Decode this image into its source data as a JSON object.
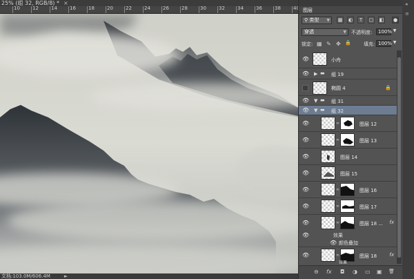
{
  "document_tab": {
    "title": "25% (组 32, RGB/8) *",
    "close": "×"
  },
  "ruler": {
    "labels": [
      "10",
      "12",
      "14",
      "16",
      "18",
      "20",
      "22",
      "24",
      "26",
      "28",
      "30",
      "32",
      "34",
      "36",
      "38",
      "40"
    ]
  },
  "status": {
    "doc_info": "文档:103.0M/606.4M",
    "arrow": "►"
  },
  "panel": {
    "collapse": "«",
    "tab_title": "图层",
    "tab_close": "≡",
    "filter": {
      "label": "类型",
      "icons": [
        "pixel-filter-icon",
        "adjustment-filter-icon",
        "type-filter-icon",
        "shape-filter-icon",
        "smart-filter-icon"
      ],
      "glyphs": [
        "▦",
        "◐",
        "T",
        "▢",
        "◧"
      ]
    },
    "blend_mode": "穿透",
    "opacity_label": "不透明度:",
    "opacity_value": "100%",
    "lock_label": "锁定:",
    "lock_glyphs": [
      "▦",
      "✎",
      "✥",
      "🔒"
    ],
    "fill_label": "填充:",
    "fill_value": "100%",
    "layers": [
      {
        "name": "小舟",
        "kind": "layer"
      },
      {
        "name": "组 19",
        "kind": "group-collapsed"
      },
      {
        "name": "椭圆 4",
        "kind": "shape",
        "locked": true
      },
      {
        "name": "组 31",
        "kind": "group-open"
      },
      {
        "name": "组 32",
        "kind": "group-open",
        "selected": true
      },
      {
        "name": "图层 12",
        "kind": "masked"
      },
      {
        "name": "图层 13",
        "kind": "masked"
      },
      {
        "name": "图层 14",
        "kind": "layer"
      },
      {
        "name": "图层 15",
        "kind": "layer"
      },
      {
        "name": "图层 16",
        "kind": "masked"
      },
      {
        "name": "图层 17",
        "kind": "masked"
      },
      {
        "name": "图层 18 ...",
        "kind": "masked",
        "fx": true
      },
      {
        "name": "图层 18",
        "kind": "masked",
        "fx": true
      }
    ],
    "effects_label": "效果",
    "effect_item": "颜色叠加",
    "fx_label": "fx",
    "bottom_effects_label": "效果",
    "bottom_icons": [
      "link-icon",
      "fx-icon",
      "mask-icon",
      "adjustment-icon",
      "new-group-icon",
      "new-layer-icon",
      "delete-icon"
    ],
    "bottom_glyphs": [
      "⊖",
      "fx",
      "◘",
      "◑",
      "▭",
      "▣",
      "🗑"
    ]
  }
}
